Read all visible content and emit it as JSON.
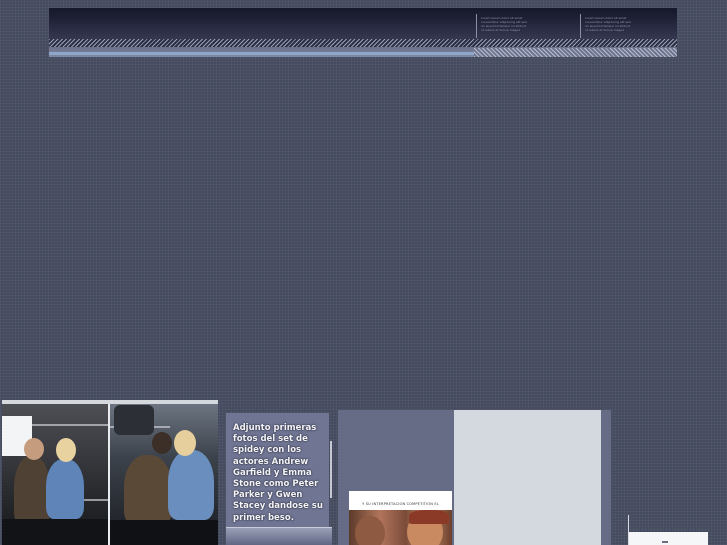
{
  "header": {
    "banner_text_1": "Lorem ipsum dolor sit amet\nconsectetur adipiscing elit sed\ndo eiusmod tempor incididunt\nut labore et dolore magna",
    "banner_text_2": "Lorem ipsum dolor sit amet\nconsectetur adipiscing elit sed\ndo eiusmod tempor incididunt\nut labore et dolore magna"
  },
  "post": {
    "caption": "Adjunto primeras fotos del set de spidey con los actores Andrew Garfield y Emma Stone como Peter Parker y Gwen Stacey dandose su primer beso."
  },
  "ad": {
    "poster_title": "Y SU INTERPRETACION COMPETITION EL"
  },
  "colors": {
    "background": "#454b5f",
    "caption_card": "#6f7592",
    "ad_panel": "#666c85",
    "ad_light": "#d3d9de"
  }
}
